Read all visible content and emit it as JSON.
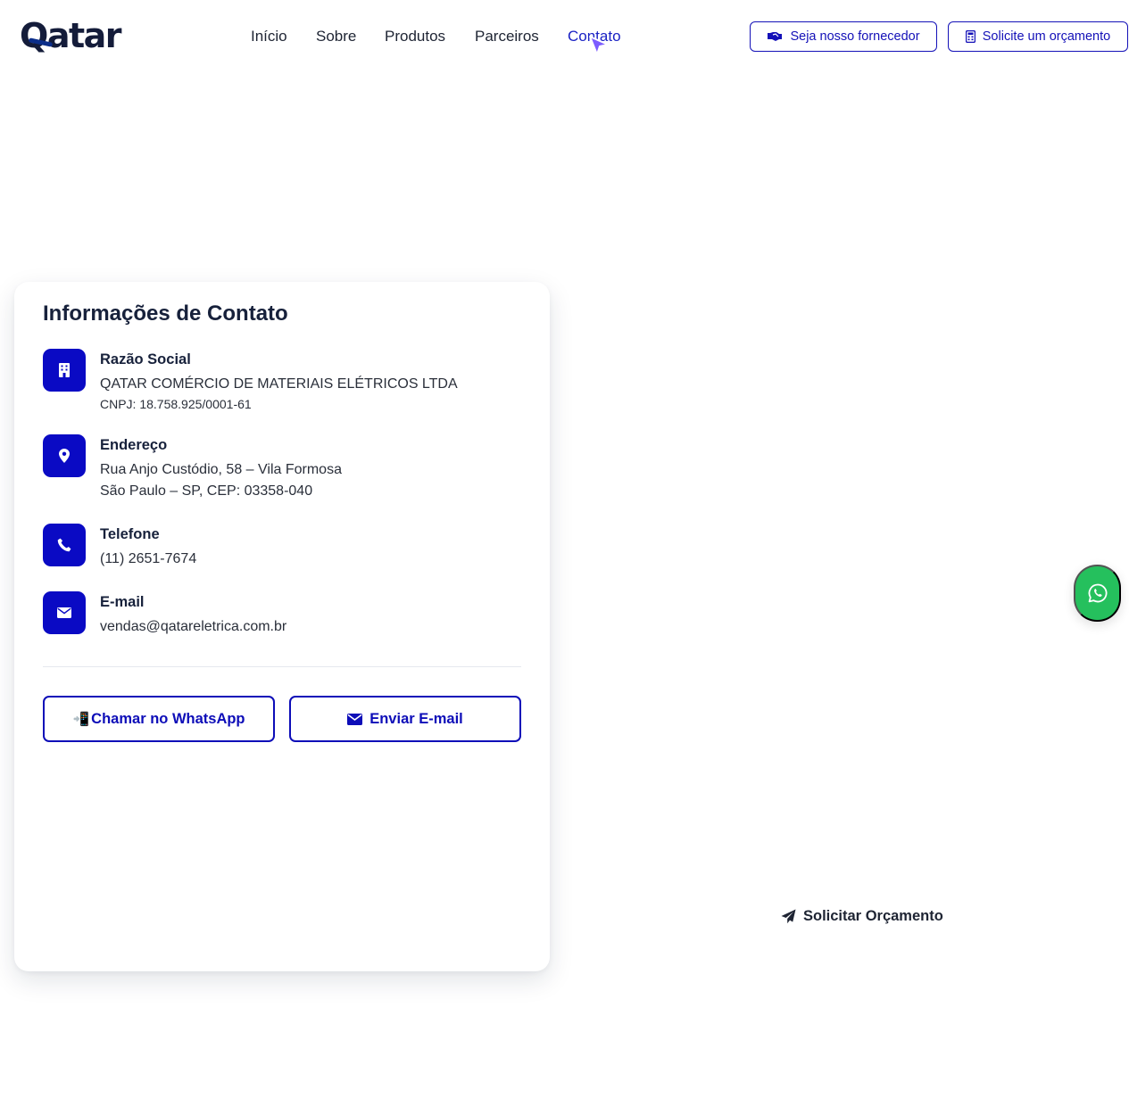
{
  "header": {
    "logo": "Qatar",
    "nav": [
      {
        "label": "Início"
      },
      {
        "label": "Sobre"
      },
      {
        "label": "Produtos"
      },
      {
        "label": "Parceiros"
      },
      {
        "label": "Contato",
        "active": true
      }
    ],
    "supplier_button": {
      "label": "Seja nosso fornecedor",
      "icon": "handshake-icon"
    },
    "quote_button": {
      "label": "Solicite um orçamento",
      "icon": "calculator-icon"
    }
  },
  "contact": {
    "title": "Informações de Contato",
    "company": {
      "label": "Razão Social",
      "name": "QATAR COMÉRCIO DE MATERIAIS ELÉTRICOS LTDA",
      "cnpj": "CNPJ: 18.758.925/0001-61",
      "icon": "building-icon"
    },
    "address": {
      "label": "Endereço",
      "line1": "Rua Anjo Custódio, 58 – Vila Formosa",
      "line2": "São Paulo – SP, CEP: 03358-040",
      "icon": "map-pin-icon"
    },
    "phone": {
      "label": "Telefone",
      "value": "(11) 2651-7674",
      "icon": "phone-icon"
    },
    "email": {
      "label": "E-mail",
      "value": "vendas@qatareletrica.com.br",
      "icon": "envelope-icon"
    },
    "whatsapp_button": {
      "label": "Chamar no WhatsApp",
      "emoji": "📲"
    },
    "email_button": {
      "label": "Enviar E-mail",
      "icon": "envelope-icon"
    }
  },
  "floating_whatsapp": {
    "icon": "whatsapp-icon"
  },
  "form_submit": {
    "label": "Solicitar Orçamento",
    "icon": "paper-plane-icon"
  },
  "colors": {
    "primary": "#0a0ac4",
    "text_dark": "#17213b",
    "whatsapp_green": "#25c05d",
    "cursor": "#7c5cff"
  }
}
